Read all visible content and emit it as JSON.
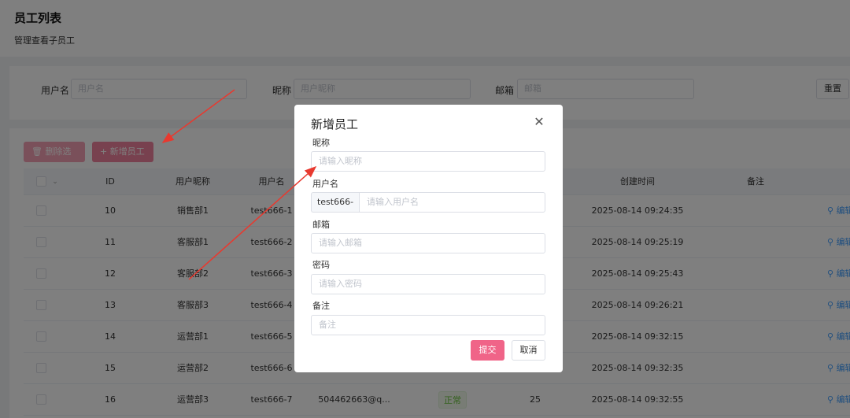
{
  "header": {
    "title": "员工列表",
    "subtitle": "管理查看子员工"
  },
  "filters": {
    "username_label": "用户名",
    "username_placeholder": "用户名",
    "nickname_label": "昵称",
    "nickname_placeholder": "用户昵称",
    "email_label": "邮箱",
    "email_placeholder": "邮箱",
    "reset_label": "重置"
  },
  "toolbar": {
    "delete_label": "删除选中",
    "add_label": "新增员工",
    "delete_icon": "trash-icon",
    "add_icon": "plus-icon"
  },
  "table": {
    "columns": {
      "id": "ID",
      "nickname": "用户昵称",
      "username": "用户名",
      "created": "创建时间",
      "remark": "备注"
    },
    "rows": [
      {
        "id": "10",
        "nickname": "销售部1",
        "username": "test666-1",
        "created": "2025-08-14 09:24:35",
        "op": "编辑"
      },
      {
        "id": "11",
        "nickname": "客服部1",
        "username": "test666-2",
        "created": "2025-08-14 09:25:19",
        "op": "编辑"
      },
      {
        "id": "12",
        "nickname": "客服部2",
        "username": "test666-3",
        "created": "2025-08-14 09:25:43",
        "op": "编辑"
      },
      {
        "id": "13",
        "nickname": "客服部3",
        "username": "test666-4",
        "created": "2025-08-14 09:26:21",
        "op": "编辑"
      },
      {
        "id": "14",
        "nickname": "运营部1",
        "username": "test666-5",
        "created": "2025-08-14 09:32:15",
        "op": "编辑"
      },
      {
        "id": "15",
        "nickname": "运营部2",
        "username": "test666-6",
        "created": "2025-08-14 09:32:35",
        "op": "编辑"
      },
      {
        "id": "16",
        "nickname": "运营部3",
        "username": "test666-7",
        "email": "504462663@q...",
        "status": "正常",
        "count": "25",
        "created": "2025-08-14 09:32:55",
        "op": "编辑"
      }
    ]
  },
  "modal": {
    "title": "新增员工",
    "nickname_label": "昵称",
    "nickname_placeholder": "请输入昵称",
    "username_label": "用户名",
    "username_prefix": "test666-",
    "username_placeholder": "请输入用户名",
    "email_label": "邮箱",
    "email_placeholder": "请输入邮箱",
    "password_label": "密码",
    "password_placeholder": "请输入密码",
    "remark_label": "备注",
    "remark_placeholder": "备注",
    "submit_label": "提交",
    "cancel_label": "取消"
  },
  "colors": {
    "accent": "#f06488",
    "annotation_arrow": "#e8392f",
    "link": "#409eff"
  }
}
